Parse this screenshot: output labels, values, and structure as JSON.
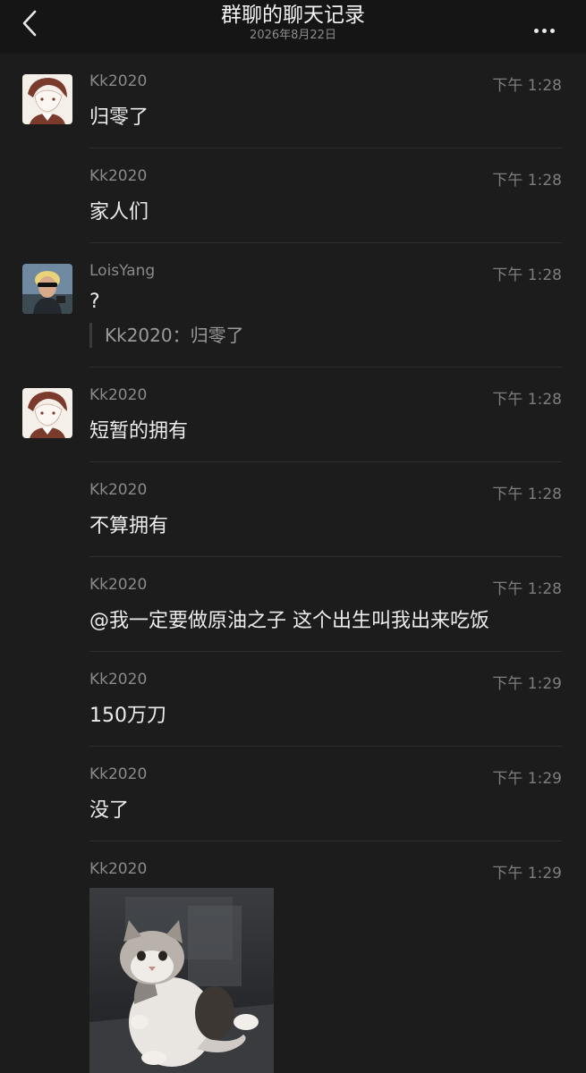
{
  "header": {
    "title": "群聊的聊天记录",
    "date": "2026年8月22日"
  },
  "messages": [
    {
      "sender": "Kk2020",
      "time": "下午 1:28",
      "text": "归零了"
    },
    {
      "sender": "Kk2020",
      "time": "下午 1:28",
      "text": "家人们"
    },
    {
      "sender": "LoisYang",
      "time": "下午 1:28",
      "text": "?",
      "quote": "Kk2020：归零了"
    },
    {
      "sender": "Kk2020",
      "time": "下午 1:28",
      "text": "短暂的拥有"
    },
    {
      "sender": "Kk2020",
      "time": "下午 1:28",
      "text": "不算拥有"
    },
    {
      "sender": "Kk2020",
      "time": "下午 1:28",
      "text": "@我一定要做原油之子 这个出生叫我出来吃饭"
    },
    {
      "sender": "Kk2020",
      "time": "下午 1:29",
      "text": "150万刀"
    },
    {
      "sender": "Kk2020",
      "time": "下午 1:29",
      "text": "没了"
    },
    {
      "sender": "Kk2020",
      "time": "下午 1:29"
    }
  ],
  "colors": {
    "background": "#1c1c1c",
    "header": "#151515",
    "divider": "#2e2e2e"
  }
}
